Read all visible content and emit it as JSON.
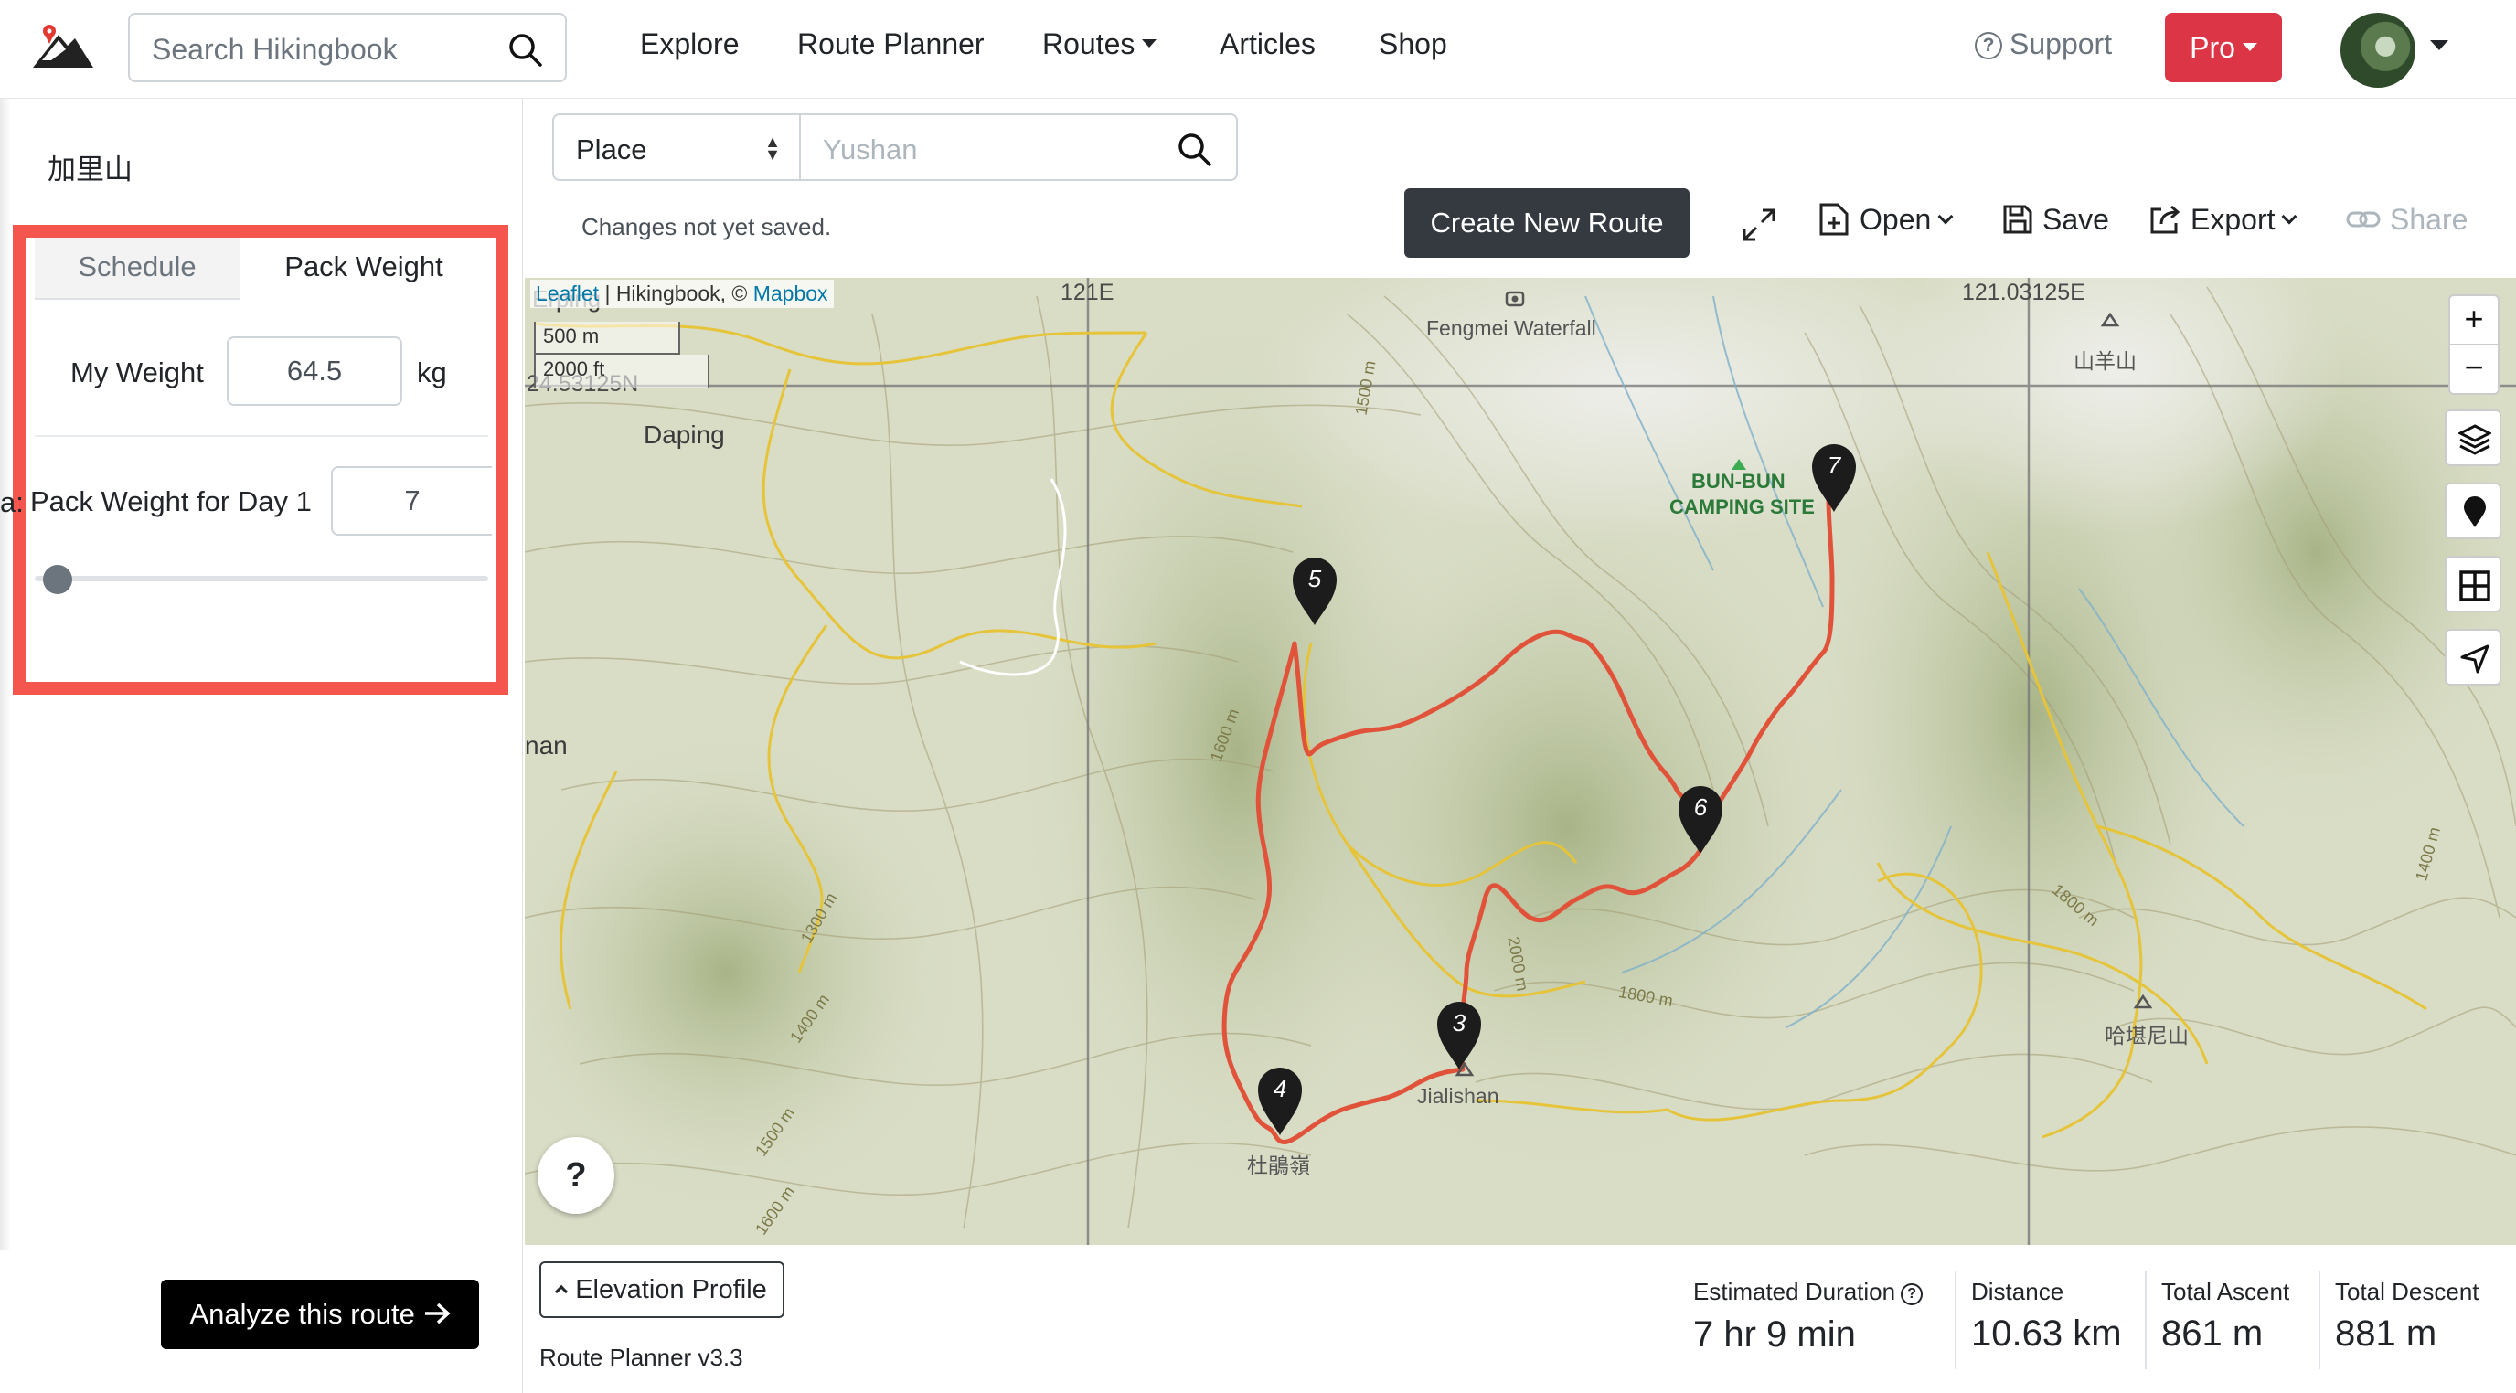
{
  "navbar": {
    "search_placeholder": "Search Hikingbook",
    "links": {
      "explore": "Explore",
      "route_planner": "Route Planner",
      "routes": "Routes",
      "articles": "Articles",
      "shop": "Shop"
    },
    "support": "Support",
    "pro": "Pro"
  },
  "sidebar": {
    "title": "加里山",
    "tabs": {
      "schedule": "Schedule",
      "pack_weight": "Pack Weight"
    },
    "my_weight_label": "My Weight",
    "my_weight_value": "64.5",
    "weight_unit": "kg",
    "edge_fragment": "a:",
    "pack_weight_day_label": "Pack Weight for Day 1",
    "pack_weight_day_value": "7",
    "slider_value_fraction": 0.02,
    "analyze_button": "Analyze this route"
  },
  "toolbar": {
    "place_select": "Place",
    "place_placeholder": "Yushan",
    "unsaved_notice": "Changes not yet saved.",
    "create_new_route": "Create New Route",
    "open": "Open",
    "save": "Save",
    "export": "Export",
    "share": "Share"
  },
  "map": {
    "attribution": {
      "leaflet": "Leaflet",
      "middle": " | Hikingbook, © ",
      "mapbox": "Mapbox"
    },
    "scale_metric": "500 m",
    "scale_imperial": "2000 ft",
    "grid_labels": {
      "lon1": "121E",
      "lon2": "121.03125E",
      "lat1": "24.53125N"
    },
    "place_labels": {
      "erping": "Erping",
      "daping": "Daping",
      "nan": "nan",
      "fengmei": "Fengmei Waterfall",
      "bunbun1": "BUN-BUN",
      "bunbun2": "CAMPING SITE",
      "shanyang": "山羊山",
      "hakanishan": "哈堪尼山",
      "jialishan": "Jialishan",
      "dujuanling": "杜鵑嶺"
    },
    "contour_labels": {
      "c1500a": "1500 m",
      "c1600a": "1600 m",
      "c1300": "1300 m",
      "c1400a": "1400 m",
      "c1500b": "1500 m",
      "c1600b": "1600 m",
      "c2000": "2000 m",
      "c1800a": "1800 m",
      "c1800b": "1800 m",
      "c1400b": "1400 m"
    },
    "waypoints": [
      "3",
      "4",
      "5",
      "6",
      "7"
    ],
    "route_color": "#e0533a",
    "trail_color": "#e6c43a",
    "help": "?"
  },
  "bottom": {
    "elevation_profile": "Elevation Profile",
    "version": "Route Planner v3.3",
    "stats": {
      "duration_label": "Estimated Duration",
      "duration_value": "7 hr 9 min",
      "distance_label": "Distance",
      "distance_value": "10.63 km",
      "ascent_label": "Total Ascent",
      "ascent_value": "861 m",
      "descent_label": "Total Descent",
      "descent_value": "881 m"
    }
  },
  "colors": {
    "pro": "#dc3545",
    "highlight_border": "#f4554d",
    "dark_button": "#343a40"
  }
}
